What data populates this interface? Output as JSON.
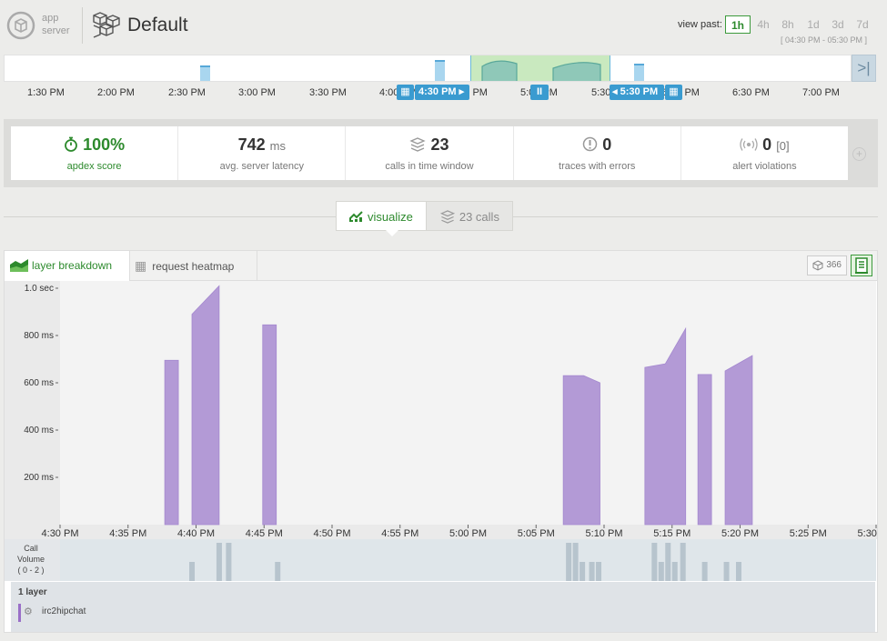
{
  "header": {
    "logo_line1": "app",
    "logo_line2": "server",
    "app_title": "Default",
    "view_past_label": "view past:",
    "view_past_options": [
      "1h",
      "4h",
      "8h",
      "1d",
      "3d",
      "7d"
    ],
    "view_past_selected": "1h",
    "view_range": "[ 04:30 PM - 05:30 PM ]"
  },
  "timeline": {
    "ticks": [
      "1:30 PM",
      "2:00 PM",
      "2:30 PM",
      "3:00 PM",
      "3:30 PM",
      "4:00 PM",
      "4:30 PM",
      "5:00 PM",
      "5:30 PM",
      "6:00 PM",
      "6:30 PM",
      "7:00 PM"
    ],
    "start_handle": "4:30 PM",
    "end_handle": "5:30 PM",
    "pause_label": "II",
    "end_button": ">|",
    "calendar_icon": "calendar-icon"
  },
  "metrics": [
    {
      "icon": "stopwatch-icon",
      "value": "100%",
      "unit": "",
      "label": "apdex score",
      "highlight": true
    },
    {
      "icon": "",
      "value": "742",
      "unit": "ms",
      "label": "avg. server latency",
      "highlight": false
    },
    {
      "icon": "stack-icon",
      "value": "23",
      "unit": "",
      "label": "calls in time window",
      "highlight": false
    },
    {
      "icon": "alert-circle-icon",
      "value": "0",
      "unit": "",
      "label": "traces with errors",
      "highlight": false
    },
    {
      "icon": "signal-icon",
      "value": "0",
      "unit": "[0]",
      "label": "alert violations",
      "highlight": false
    }
  ],
  "view_toggle": {
    "visualize_label": "visualize",
    "calls_label": "23 calls"
  },
  "panel": {
    "tab_layer_breakdown": "layer breakdown",
    "tab_request_heatmap": "request heatmap",
    "count_badge": "366",
    "call_volume_label_1": "Call",
    "call_volume_label_2": "Volume",
    "call_volume_label_3": "( 0 - 2 )",
    "layers_count": "1 layer",
    "layer_name": "irc2hipchat",
    "layer_color": "#9a6fc8"
  },
  "chart_data": {
    "type": "area",
    "series": [
      {
        "name": "irc2hipchat",
        "color": "#b39ad6"
      }
    ],
    "y_ticks": [
      "1.0 sec",
      "800 ms",
      "600 ms",
      "400 ms",
      "200 ms"
    ],
    "y_tick_values": [
      1000,
      800,
      600,
      400,
      200
    ],
    "ylim": [
      0,
      1000
    ],
    "x_ticks": [
      "4:30 PM",
      "4:35 PM",
      "4:40 PM",
      "4:45 PM",
      "4:50 PM",
      "4:55 PM",
      "5:00 PM",
      "5:05 PM",
      "5:10 PM",
      "5:15 PM",
      "5:20 PM",
      "5:25 PM",
      "5:30 PM"
    ],
    "xlim_minutes_after_4_30": [
      0,
      60
    ],
    "segments": [
      {
        "points": [
          [
            7.7,
            695
          ],
          [
            8.7,
            695
          ]
        ]
      },
      {
        "points": [
          [
            9.7,
            890
          ],
          [
            11.7,
            1010
          ]
        ]
      },
      {
        "points": [
          [
            14.9,
            845
          ],
          [
            15.9,
            845
          ]
        ]
      },
      {
        "points": [
          [
            37.0,
            630
          ],
          [
            38.5,
            630
          ],
          [
            39.7,
            600
          ]
        ]
      },
      {
        "points": [
          [
            43.0,
            665
          ],
          [
            44.5,
            680
          ],
          [
            46.0,
            830
          ]
        ]
      },
      {
        "points": [
          [
            46.9,
            635
          ],
          [
            47.9,
            635
          ]
        ]
      },
      {
        "points": [
          [
            48.9,
            650
          ],
          [
            50.9,
            715
          ]
        ]
      }
    ],
    "call_volume": {
      "range": [
        0,
        2
      ],
      "bars": [
        [
          9.5,
          1
        ],
        [
          11.5,
          2
        ],
        [
          12.2,
          2
        ],
        [
          15.8,
          1
        ],
        [
          37.2,
          2
        ],
        [
          37.7,
          2
        ],
        [
          38.2,
          1
        ],
        [
          38.9,
          1
        ],
        [
          39.4,
          1
        ],
        [
          43.5,
          2
        ],
        [
          44.0,
          1
        ],
        [
          44.5,
          2
        ],
        [
          45.0,
          1
        ],
        [
          45.6,
          2
        ],
        [
          47.2,
          1
        ],
        [
          48.8,
          1
        ],
        [
          49.7,
          1
        ]
      ]
    }
  }
}
